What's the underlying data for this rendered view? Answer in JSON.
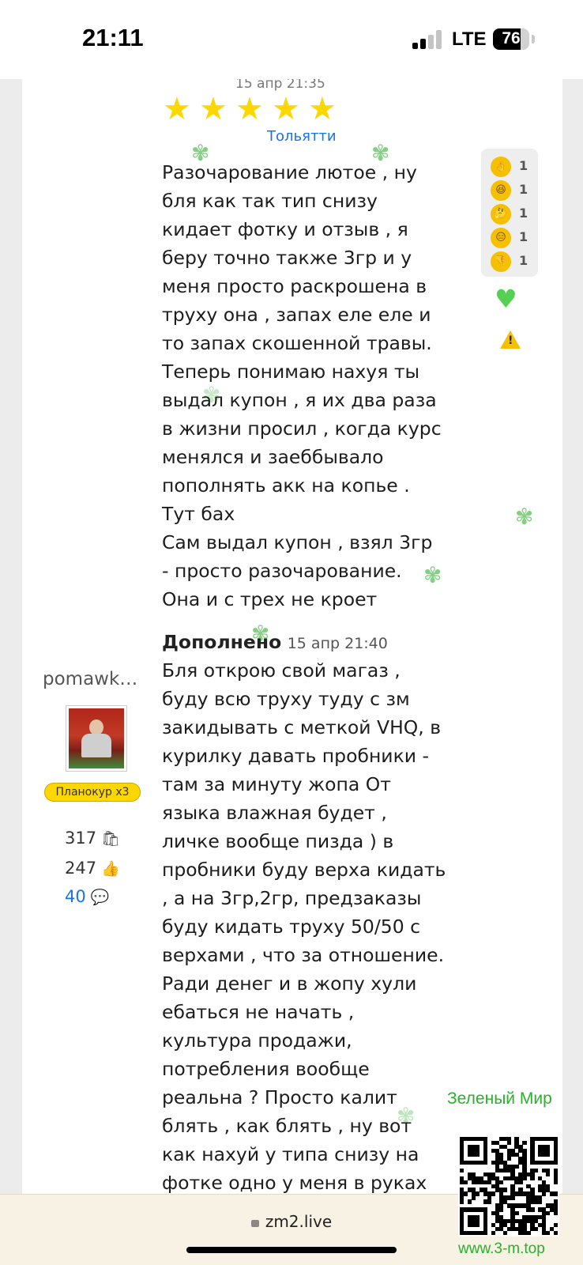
{
  "status_bar": {
    "time": "21:11",
    "network": "LTE",
    "battery_level": "76",
    "battery_fraction": 0.76,
    "signal_bars_active": 2,
    "signal_bars_total": 4
  },
  "post": {
    "date": "15 апр 21:35",
    "rating": 5,
    "rating_max": 5,
    "city": "Тольятти",
    "body_lines": [
      "Разочарование лютое , ну",
      "бля как так тип снизу",
      "кидает фотку и отзыв , я",
      "беру точно также 3гр и у",
      "меня просто раскрошена в",
      "труху она , запах еле еле и",
      "то запах скошенной травы.",
      "Теперь понимаю нахуя ты",
      "выдал купон , я их два раза",
      "в жизни просил , когда курс",
      "менялся и заеббывало",
      "пополнять акк на копье .",
      "Тут бах",
      "Сам выдал купон , взял 3гр",
      "- просто разочарование.",
      "Она и с трех не кроет"
    ],
    "added_label": "Дополнено",
    "added_date": "15 апр 21:40",
    "added_lines": [
      "Бля открою свой магаз ,",
      "буду всю труху туду с зм",
      "закидывать с меткой VHQ, в",
      "курилку давать пробники -",
      "там за минуту жопа От",
      "языка влажная будет ,",
      "личке вообще пизда ) в",
      "пробники буду верха кидать",
      ", а на 3гр,2гр, предзаказы",
      "буду кидать труху 50/50 с",
      "верхами , что за отношение.",
      "Ради денег и в жопу хули",
      "ебаться не начать ,",
      "культура продажи,",
      "потребления вообще",
      "реальна ? Просто калит",
      "блять , как блять , ну вот",
      "как нахуй у типа снизу на",
      "фотке одно у меня в руках"
    ]
  },
  "reactions": [
    {
      "icon": "ok-hand-icon",
      "glyph": "👌",
      "count": "1"
    },
    {
      "icon": "laughing-face-icon",
      "glyph": "😆",
      "count": "1"
    },
    {
      "icon": "thinking-face-icon",
      "glyph": "🤔",
      "count": "1"
    },
    {
      "icon": "unamused-face-icon",
      "glyph": "😑",
      "count": "1"
    },
    {
      "icon": "thumbs-down-icon",
      "glyph": "👎",
      "count": "1"
    }
  ],
  "author": {
    "username": "pomawk…",
    "rank": "Планокур x3",
    "stats": [
      {
        "value": "317",
        "icon": "bag-icon",
        "glyph": "🛍"
      },
      {
        "value": "247",
        "icon": "thumbs-up-icon",
        "glyph": "👍"
      },
      {
        "value": "40",
        "icon": "comment-icon",
        "glyph": "💬"
      }
    ]
  },
  "watermark": {
    "title": "Зеленый Мир",
    "url": "www.3-m.top"
  },
  "browser": {
    "address": "zm2.live"
  },
  "colors": {
    "accent_link": "#1a73e8",
    "star": "#ffd700",
    "heart": "#55d055",
    "watermark_green": "#2bb02b"
  }
}
